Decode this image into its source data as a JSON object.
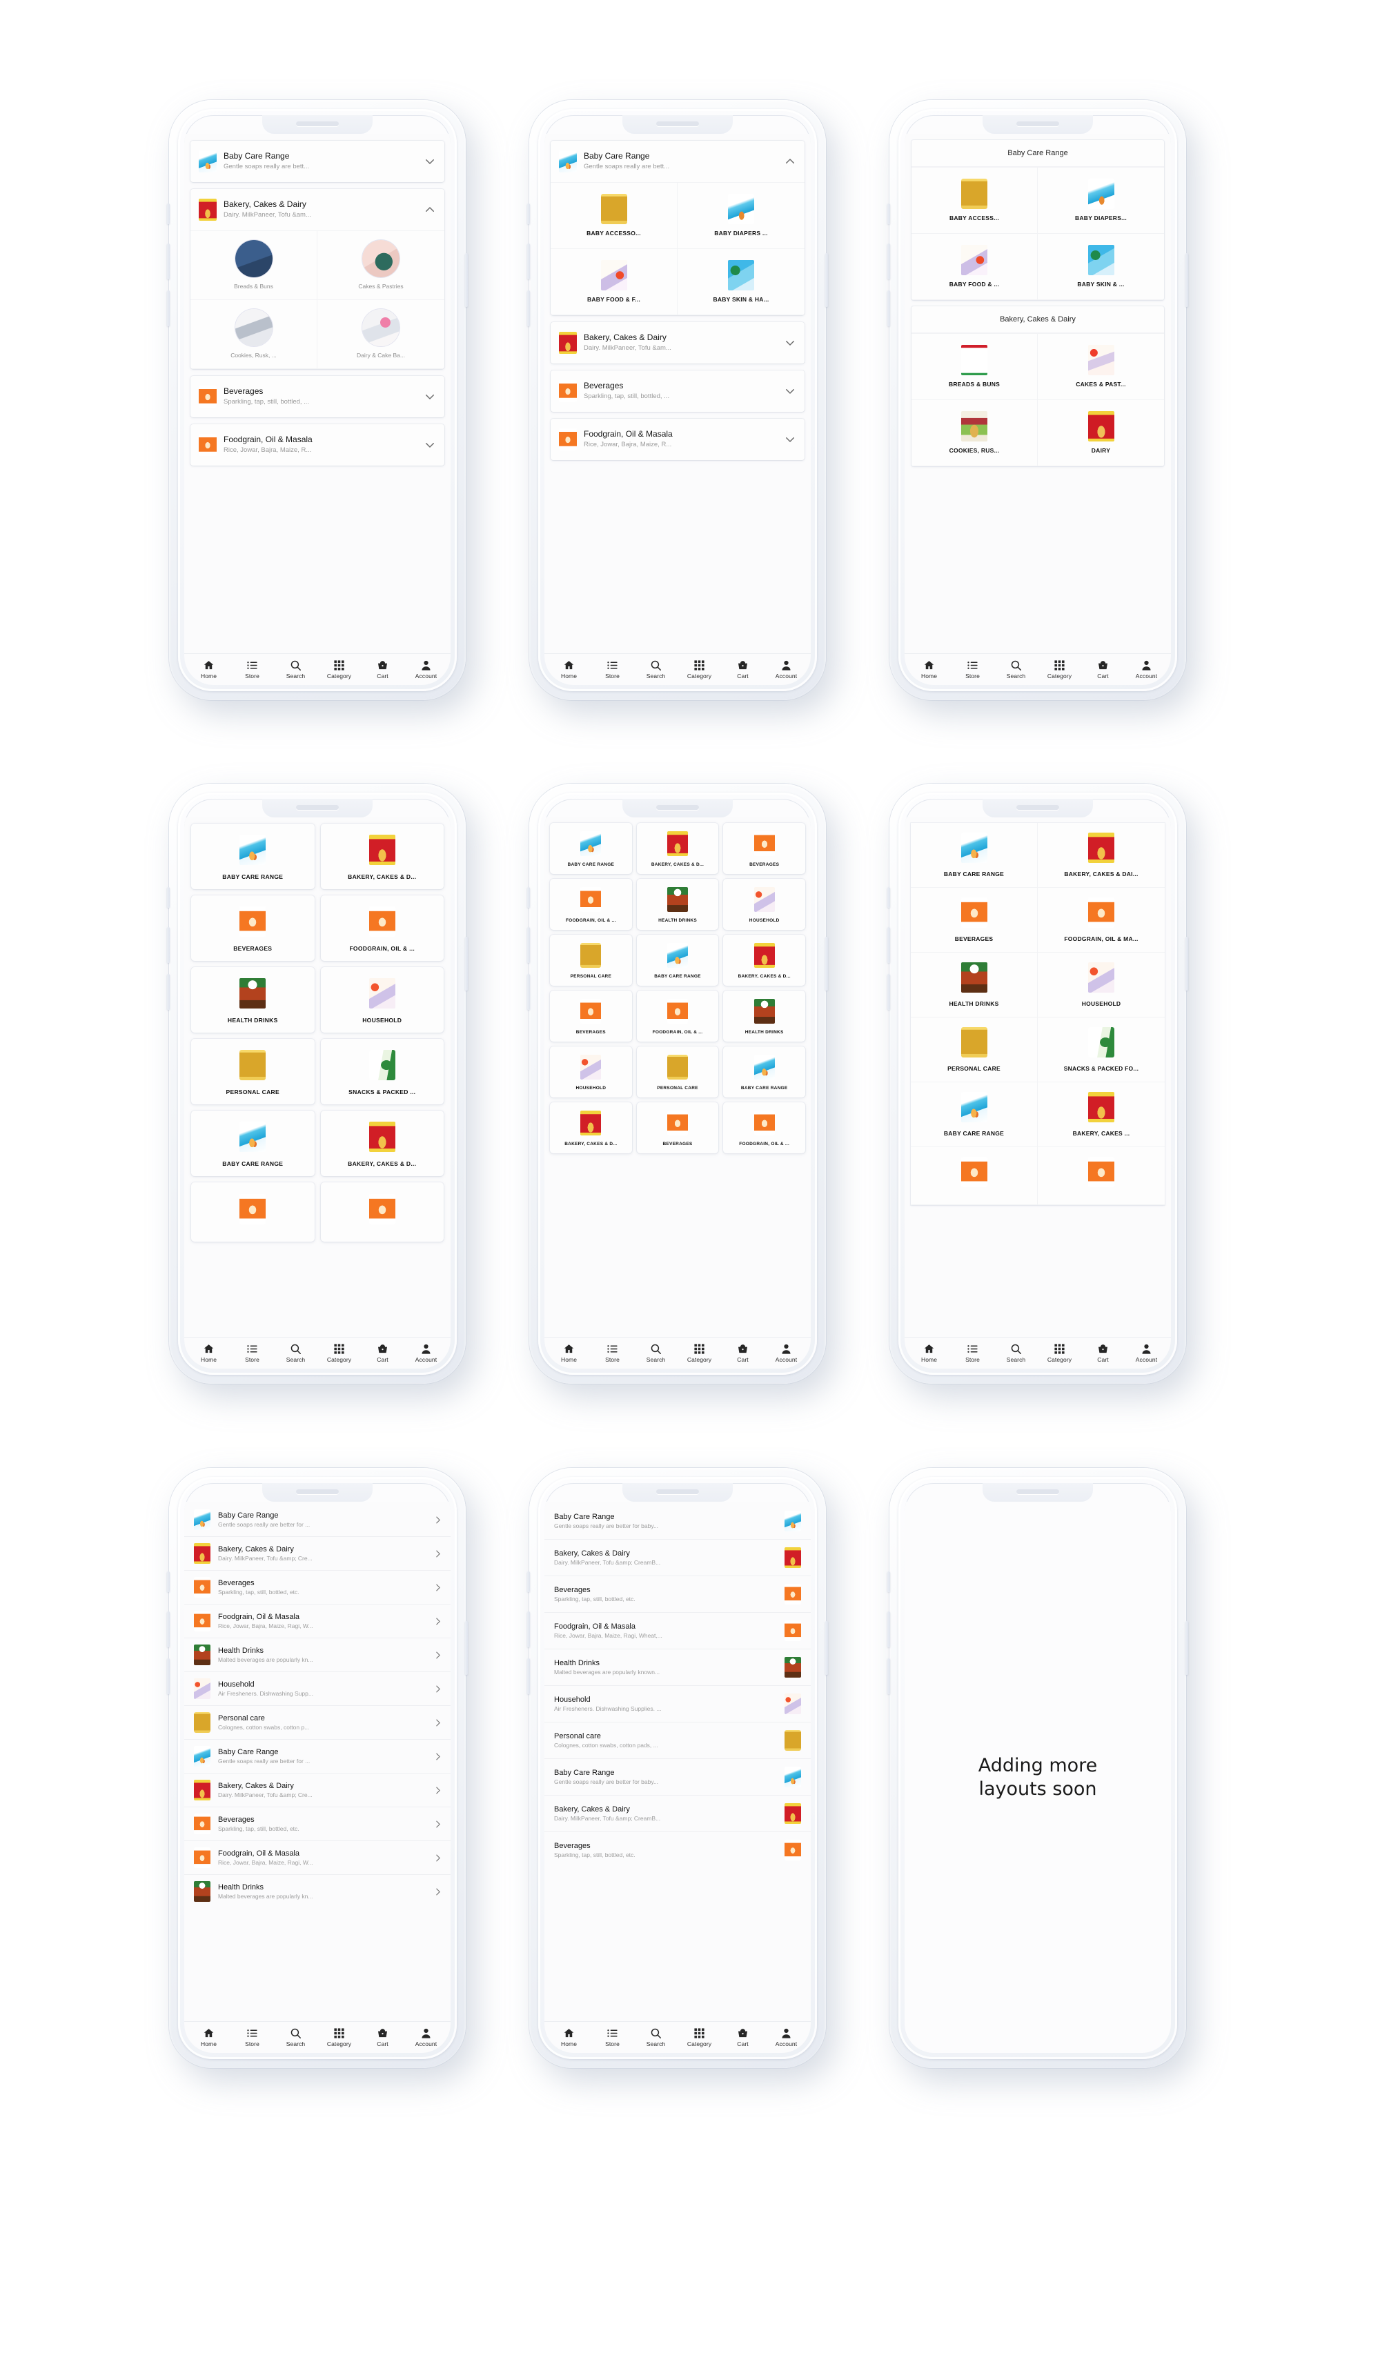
{
  "page": {
    "background": "#ffffff",
    "device_count": 9
  },
  "tabbar": {
    "items": [
      {
        "label": "Home",
        "icon": "home-icon"
      },
      {
        "label": "Store",
        "icon": "list-icon"
      },
      {
        "label": "Search",
        "icon": "search-icon"
      },
      {
        "label": "Category",
        "icon": "grid-icon"
      },
      {
        "label": "Cart",
        "icon": "basket-icon"
      },
      {
        "label": "Account",
        "icon": "person-icon"
      }
    ]
  },
  "categories": {
    "baby_care": {
      "title": "Baby Care Range",
      "subtitle": "Gentle soaps really are bett...",
      "subtitle_long": "Gentle soaps really are better for ...",
      "subtitle_alt": "Gentle soaps really are better for baby...",
      "upper": "BABY CARE RANGE",
      "art": "art-babycare"
    },
    "bakery": {
      "title": "Bakery, Cakes & Dairy",
      "subtitle": "Dairy. MilkPaneer, Tofu &am...",
      "subtitle_long": "Dairy. MilkPaneer, Tofu &amp; Cre...",
      "subtitle_alt": "Dairy. MilkPaneer, Tofu &amp; CreamB...",
      "upper": "BAKERY, CAKES & D...",
      "art": "art-bakery"
    },
    "beverages": {
      "title": "Beverages",
      "subtitle": "Sparkling, tap, still, bottled, ...",
      "subtitle_long": "Sparkling, tap, still, bottled, etc.",
      "subtitle_alt": "Sparkling, tap, still, bottled, etc.",
      "upper": "BEVERAGES",
      "art": "art-beverage"
    },
    "foodgrain": {
      "title": "Foodgrain, Oil & Masala",
      "subtitle": "Rice, Jowar, Bajra, Maize, R...",
      "subtitle_long": "Rice, Jowar, Bajra, Maize, Ragi, W...",
      "subtitle_alt": "Rice, Jowar, Bajra, Maize, Ragi, Wheat,...",
      "upper": "FOODGRAIN, OIL & ...",
      "art": "art-beverage"
    },
    "health": {
      "title": "Health Drinks",
      "subtitle": "Malted beverages are popularly kn...",
      "subtitle_long": "Malted beverages are popularly kn...",
      "subtitle_alt": "Malted beverages are popularly known...",
      "upper": "HEALTH DRINKS",
      "art": "art-health"
    },
    "household": {
      "title": "Household",
      "subtitle": "Air Fresheners. Dishwashing Supp...",
      "subtitle_long": "Air Fresheners. Dishwashing Supp...",
      "subtitle_alt": "Air Fresheners. Dishwashing Supplies. ...",
      "upper": "HOUSEHOLD",
      "art": "art-household"
    },
    "personal": {
      "title": "Personal care",
      "subtitle": "Colognes, cotton swabs, cotton p...",
      "subtitle_long": "Colognes, cotton swabs, cotton p...",
      "subtitle_alt": "Colognes, cotton swabs, cotton pads, ...",
      "upper": "PERSONAL CARE",
      "art": "art-personal"
    },
    "snacks": {
      "title": "Snacks & Packed Food",
      "subtitle": "Namkeen, chips, biscuits, ...",
      "subtitle_long": "Namkeen, chips, biscuits, ...",
      "subtitle_alt": "Namkeen, chips, biscuits, ...",
      "upper": "SNACKS & PACKED ...",
      "art": "art-snacks"
    }
  },
  "phone1": {
    "layout_name": "accordion-expanded-circles",
    "rows": [
      {
        "key": "baby_care",
        "expanded": false,
        "chevron": "chevron-down-icon"
      },
      {
        "key": "bakery",
        "expanded": true,
        "chevron": "chevron-up-icon",
        "children": [
          {
            "label": "Breads & Buns",
            "art": "art-phone"
          },
          {
            "label": "Cakes & Pastries",
            "art": "art-shoe"
          },
          {
            "label": "Cookies, Rusk, ...",
            "art": "art-desk"
          },
          {
            "label": "Dairy & Cake Ba...",
            "art": "art-flowers"
          }
        ]
      },
      {
        "key": "beverages",
        "expanded": false,
        "chevron": "chevron-down-icon"
      },
      {
        "key": "foodgrain",
        "expanded": false,
        "chevron": "chevron-down-icon"
      }
    ]
  },
  "phone2": {
    "layout_name": "accordion-expanded-packshots",
    "rows": [
      {
        "key": "baby_care",
        "expanded": true,
        "chevron": "chevron-up-icon",
        "children": [
          {
            "label": "BABY ACCESSO...",
            "art": "art-personal"
          },
          {
            "label": "BABY DIAPERS ...",
            "art": "art-diapers"
          },
          {
            "label": "BABY FOOD & F...",
            "art": "art-babyfood"
          },
          {
            "label": "BABY SKIN & HA...",
            "art": "art-babyskin"
          }
        ]
      },
      {
        "key": "bakery",
        "expanded": false,
        "chevron": "chevron-down-icon"
      },
      {
        "key": "beverages",
        "expanded": false,
        "chevron": "chevron-down-icon"
      },
      {
        "key": "foodgrain",
        "expanded": false,
        "chevron": "chevron-down-icon"
      }
    ]
  },
  "phone3": {
    "layout_name": "sectioned-card-grid",
    "sections": [
      {
        "title": "Baby Care Range",
        "items": [
          {
            "label": "BABY ACCESS...",
            "art": "art-personal"
          },
          {
            "label": "BABY DIAPERS...",
            "art": "art-diapers"
          },
          {
            "label": "BABY FOOD & ...",
            "art": "art-babyfood"
          },
          {
            "label": "BABY SKIN & ...",
            "art": "art-babyskin"
          }
        ]
      },
      {
        "title": "Bakery, Cakes & Dairy",
        "items": [
          {
            "label": "BREADS & BUNS",
            "art": "art-bread"
          },
          {
            "label": "CAKES & PAST...",
            "art": "art-cakes"
          },
          {
            "label": "COOKIES, RUS...",
            "art": "art-cookies"
          },
          {
            "label": "DAIRY",
            "art": "art-dairy"
          }
        ]
      }
    ]
  },
  "phone4": {
    "layout_name": "two-column-cards",
    "items": [
      {
        "label": "BABY CARE RANGE",
        "art": "art-babycare"
      },
      {
        "label": "BAKERY, CAKES & D...",
        "art": "art-bakery"
      },
      {
        "label": "BEVERAGES",
        "art": "art-beverage"
      },
      {
        "label": "FOODGRAIN, OIL & ...",
        "art": "art-beverage"
      },
      {
        "label": "HEALTH DRINKS",
        "art": "art-health"
      },
      {
        "label": "HOUSEHOLD",
        "art": "art-household"
      },
      {
        "label": "PERSONAL CARE",
        "art": "art-personal"
      },
      {
        "label": "SNACKS & PACKED ...",
        "art": "art-snacks"
      },
      {
        "label": "BABY CARE RANGE",
        "art": "art-babycare"
      },
      {
        "label": "BAKERY, CAKES & D...",
        "art": "art-bakery"
      },
      {
        "label": "",
        "art": "art-beverage"
      },
      {
        "label": "",
        "art": "art-beverage"
      }
    ]
  },
  "phone5": {
    "layout_name": "three-column-cards",
    "items": [
      {
        "label": "BABY CARE RANGE",
        "art": "art-babycare"
      },
      {
        "label": "BAKERY, CAKES & D...",
        "art": "art-bakery"
      },
      {
        "label": "BEVERAGES",
        "art": "art-beverage"
      },
      {
        "label": "FOODGRAIN, OIL & ...",
        "art": "art-beverage"
      },
      {
        "label": "HEALTH DRINKS",
        "art": "art-health"
      },
      {
        "label": "HOUSEHOLD",
        "art": "art-household"
      },
      {
        "label": "PERSONAL CARE",
        "art": "art-personal"
      },
      {
        "label": "BABY CARE RANGE",
        "art": "art-babycare"
      },
      {
        "label": "BAKERY, CAKES & D...",
        "art": "art-bakery"
      },
      {
        "label": "BEVERAGES",
        "art": "art-beverage"
      },
      {
        "label": "FOODGRAIN, OIL & ...",
        "art": "art-beverage"
      },
      {
        "label": "HEALTH DRINKS",
        "art": "art-health"
      },
      {
        "label": "HOUSEHOLD",
        "art": "art-household"
      },
      {
        "label": "PERSONAL CARE",
        "art": "art-personal"
      },
      {
        "label": "BABY CARE RANGE",
        "art": "art-babycare"
      },
      {
        "label": "BAKERY, CAKES & D...",
        "art": "art-bakery"
      },
      {
        "label": "BEVERAGES",
        "art": "art-beverage"
      },
      {
        "label": "FOODGRAIN, OIL & ...",
        "art": "art-beverage"
      }
    ]
  },
  "phone6": {
    "layout_name": "two-column-plain-grid",
    "items": [
      {
        "label": "BABY CARE RANGE",
        "art": "art-babycare"
      },
      {
        "label": "BAKERY, CAKES & DAI...",
        "art": "art-bakery"
      },
      {
        "label": "BEVERAGES",
        "art": "art-beverage"
      },
      {
        "label": "FOODGRAIN, OIL & MA...",
        "art": "art-beverage"
      },
      {
        "label": "HEALTH DRINKS",
        "art": "art-health"
      },
      {
        "label": "HOUSEHOLD",
        "art": "art-household"
      },
      {
        "label": "PERSONAL CARE",
        "art": "art-personal"
      },
      {
        "label": "SNACKS & PACKED FO...",
        "art": "art-snacks"
      },
      {
        "label": "BABY CARE RANGE",
        "art": "art-babycare"
      },
      {
        "label": "BAKERY, CAKES ...",
        "art": "art-bakery"
      },
      {
        "label": "",
        "art": "art-beverage"
      },
      {
        "label": "",
        "art": "art-beverage"
      }
    ]
  },
  "phone7": {
    "layout_name": "list-left-thumbnail",
    "items": [
      {
        "key": "baby_care"
      },
      {
        "key": "bakery"
      },
      {
        "key": "beverages"
      },
      {
        "key": "foodgrain"
      },
      {
        "key": "health"
      },
      {
        "key": "household"
      },
      {
        "key": "personal"
      },
      {
        "key": "baby_care"
      },
      {
        "key": "bakery"
      },
      {
        "key": "beverages"
      },
      {
        "key": "foodgrain"
      },
      {
        "key": "health"
      }
    ],
    "carat": "chevron-right-icon"
  },
  "phone8": {
    "layout_name": "list-right-thumbnail",
    "items": [
      {
        "key": "baby_care"
      },
      {
        "key": "bakery"
      },
      {
        "key": "beverages"
      },
      {
        "key": "foodgrain"
      },
      {
        "key": "health"
      },
      {
        "key": "household"
      },
      {
        "key": "personal"
      },
      {
        "key": "baby_care"
      },
      {
        "key": "bakery"
      },
      {
        "key": "beverages"
      }
    ]
  },
  "phone9": {
    "layout_name": "placeholder",
    "message": "Adding more layouts soon"
  }
}
